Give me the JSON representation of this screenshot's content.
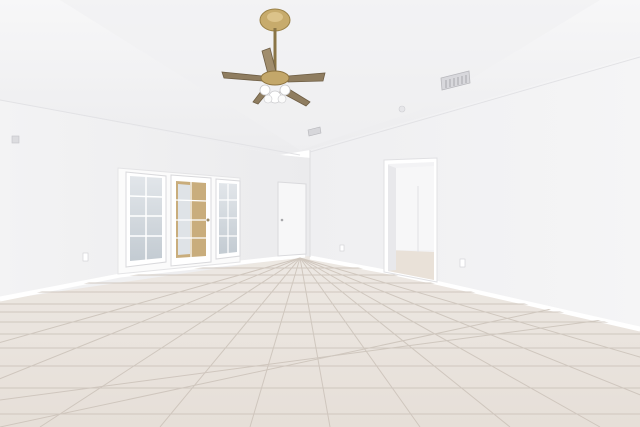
{
  "scene": {
    "type": "photo",
    "colors": {
      "wall": "#f2f2f3",
      "ceiling": "#f6f6f7",
      "floor_tile": "#e9e3dd",
      "grout": "#cfc6bd",
      "fan_brass": "#b69a62",
      "fan_blade": "#8a7a60",
      "glass": "#cfd6dc",
      "door_frame": "#ffffff"
    }
  }
}
